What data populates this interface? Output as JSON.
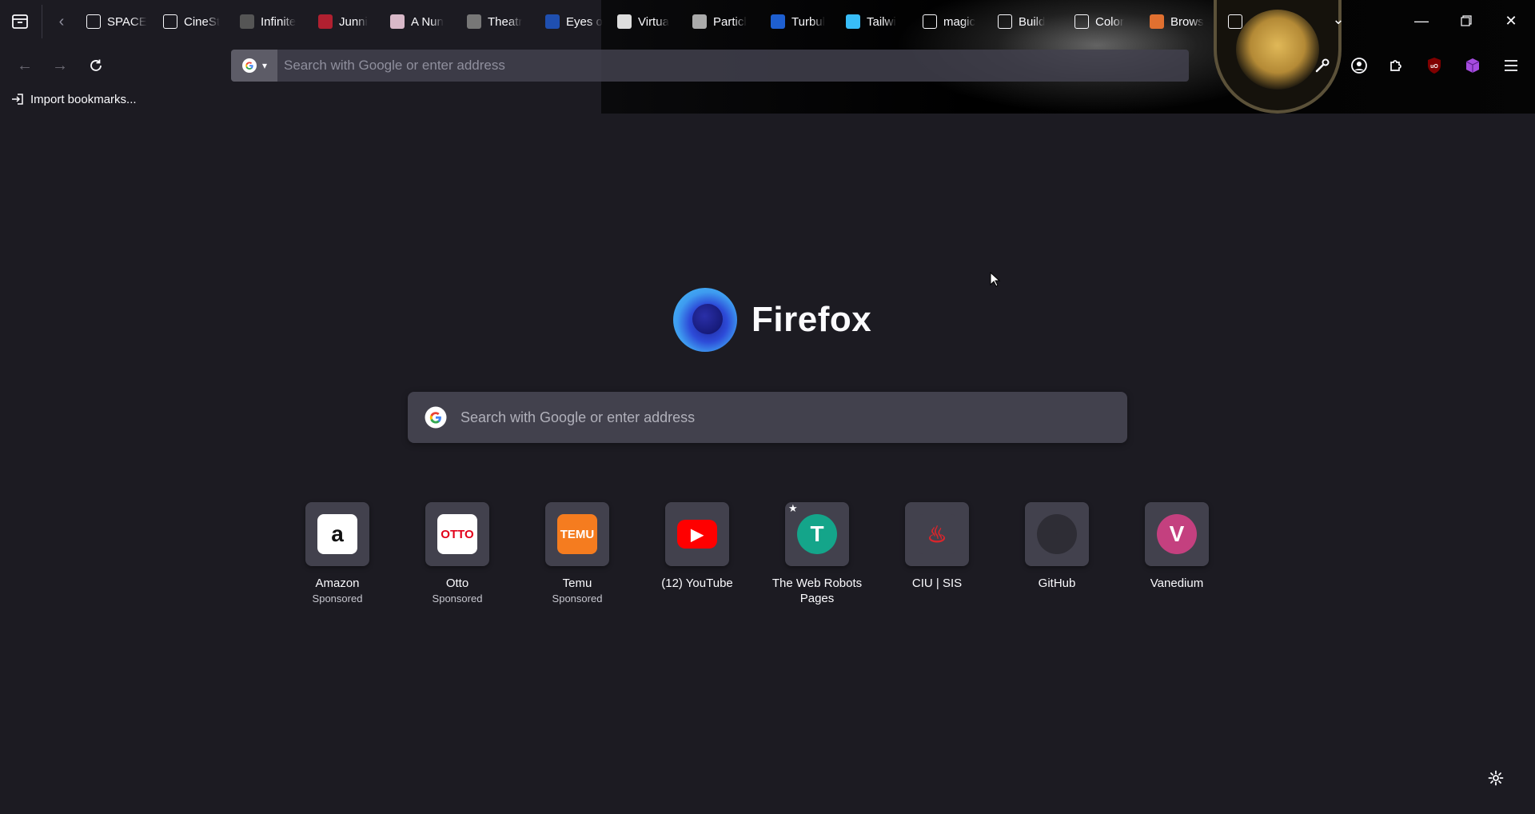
{
  "tabs": [
    {
      "label": "SPACE",
      "icon": "x-icon",
      "color": "#ffffff"
    },
    {
      "label": "CineSt",
      "icon": "c-icon",
      "color": "#ffffff"
    },
    {
      "label": "Infinite",
      "icon": "dash-icon",
      "color": "#555555"
    },
    {
      "label": "Junni",
      "icon": "junni-icon",
      "color": "#b02030"
    },
    {
      "label": "A Nun",
      "icon": "nun-icon",
      "color": "#d8b8c8"
    },
    {
      "label": "Theatr",
      "icon": "theatre-icon",
      "color": "#777777"
    },
    {
      "label": "Eyes o",
      "icon": "nasa-icon",
      "color": "#1f4fb0"
    },
    {
      "label": "Virtua",
      "icon": "virtual-icon",
      "color": "#dddddd"
    },
    {
      "label": "Particl",
      "icon": "particle-icon",
      "color": "#aaaaaa"
    },
    {
      "label": "Turbul",
      "icon": "t-icon",
      "color": "#1e5fd0"
    },
    {
      "label": "Tailwi",
      "icon": "tailwind-icon",
      "color": "#38bdf8"
    },
    {
      "label": "magic",
      "icon": "google-icon",
      "color": "#ffffff"
    },
    {
      "label": "Build",
      "icon": "pen-icon",
      "color": "#ffffff"
    },
    {
      "label": "Color",
      "icon": "color-icon",
      "color": "#ffffff"
    },
    {
      "label": "Brows",
      "icon": "browse-icon",
      "color": "#e07030"
    },
    {
      "label": "",
      "icon": "google-icon",
      "color": "#ffffff"
    }
  ],
  "urlbar": {
    "placeholder": "Search with Google or enter address"
  },
  "bookmarks": {
    "import_label": "Import bookmarks..."
  },
  "brand": {
    "wordmark": "Firefox"
  },
  "search": {
    "placeholder": "Search with Google or enter address"
  },
  "shortcuts": [
    {
      "title": "Amazon",
      "sub": "Sponsored",
      "icon": "amazon-icon",
      "letter": "a",
      "bg": "#ffffff",
      "fg": "#111111"
    },
    {
      "title": "Otto",
      "sub": "Sponsored",
      "icon": "otto-icon",
      "letter": "OTTO",
      "bg": "#ffffff",
      "fg": "#e2001a"
    },
    {
      "title": "Temu",
      "sub": "Sponsored",
      "icon": "temu-icon",
      "letter": "TEMU",
      "bg": "#f57c1f",
      "fg": "#ffffff"
    },
    {
      "title": "(12) YouTube",
      "sub": "",
      "icon": "youtube-icon",
      "letter": "▶",
      "bg": "#ff0000",
      "fg": "#ffffff"
    },
    {
      "title": "The Web Robots Pages",
      "sub": "",
      "icon": "letter-t-icon",
      "letter": "T",
      "bg": "#14a58a",
      "fg": "#ffffff",
      "pinned": true
    },
    {
      "title": "CIU | SIS",
      "sub": "",
      "icon": "ciu-icon",
      "letter": "♨",
      "bg": "#42414d",
      "fg": "#d8262c"
    },
    {
      "title": "GitHub",
      "sub": "",
      "icon": "github-icon",
      "letter": "●",
      "bg": "#42414d",
      "fg": "#2a2a30"
    },
    {
      "title": "Vanedium",
      "sub": "",
      "icon": "letter-v-icon",
      "letter": "V",
      "bg": "#c4407f",
      "fg": "#ffffff"
    }
  ]
}
